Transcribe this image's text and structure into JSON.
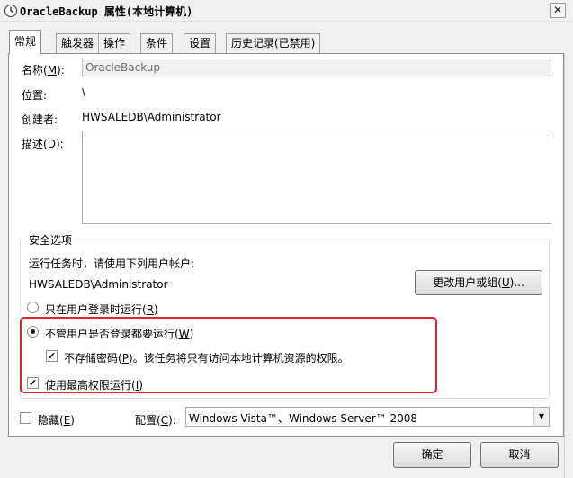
{
  "window": {
    "title": "OracleBackup 属性(本地计算机)",
    "close_glyph": "✕",
    "icon": "task-scheduler-clock-icon"
  },
  "tabs": [
    {
      "label": "常规",
      "active": true
    },
    {
      "label": "触发器",
      "active": false
    },
    {
      "label": "操作",
      "active": false
    },
    {
      "label": "条件",
      "active": false
    },
    {
      "label": "设置",
      "active": false
    },
    {
      "label": "历史记录(已禁用)",
      "active": false
    }
  ],
  "general": {
    "name_label": "名称(",
    "name_key": "M",
    "name_label_end": "):",
    "name_value": "OracleBackup",
    "location_label": "位置:",
    "location_value": "\\",
    "author_label": "创建者:",
    "author_value": "HWSALEDB\\Administrator",
    "description_label": "描述(",
    "description_key": "D",
    "description_label_end": "):",
    "description_value": ""
  },
  "security": {
    "group_title": "安全选项",
    "run_as_prompt": "运行任务时，请使用下列用户帐户:",
    "run_as_user": "HWSALEDB\\Administrator",
    "change_user_button": {
      "text": "更改用户或组(",
      "key": "U",
      "end": ")..."
    },
    "radio_logged_on": {
      "text": "只在用户登录时运行(",
      "key": "R",
      "end": ")",
      "checked": false
    },
    "radio_whether_logged_on": {
      "text": "不管用户是否登录都要运行(",
      "key": "W",
      "end": ")",
      "checked": true
    },
    "check_no_store_password": {
      "text": "不存储密码(",
      "key": "P",
      "end": ")。该任务将只有访问本地计算机资源的权限。",
      "checked": true
    },
    "check_highest_privileges": {
      "text": "使用最高权限运行(",
      "key": "I",
      "end": ")",
      "checked": true
    }
  },
  "bottom": {
    "hidden": {
      "text": "隐藏(",
      "key": "E",
      "end": ")",
      "checked": false
    },
    "configure_label": "配置(",
    "configure_key": "C",
    "configure_end": "):",
    "configure_value": "Windows Vista™、Windows Server™ 2008"
  },
  "buttons": {
    "ok": "确定",
    "cancel": "取消"
  },
  "colors": {
    "highlight": "#e8202a",
    "panel_bg": "#ffffff",
    "window_bg": "#f0f0f0"
  }
}
